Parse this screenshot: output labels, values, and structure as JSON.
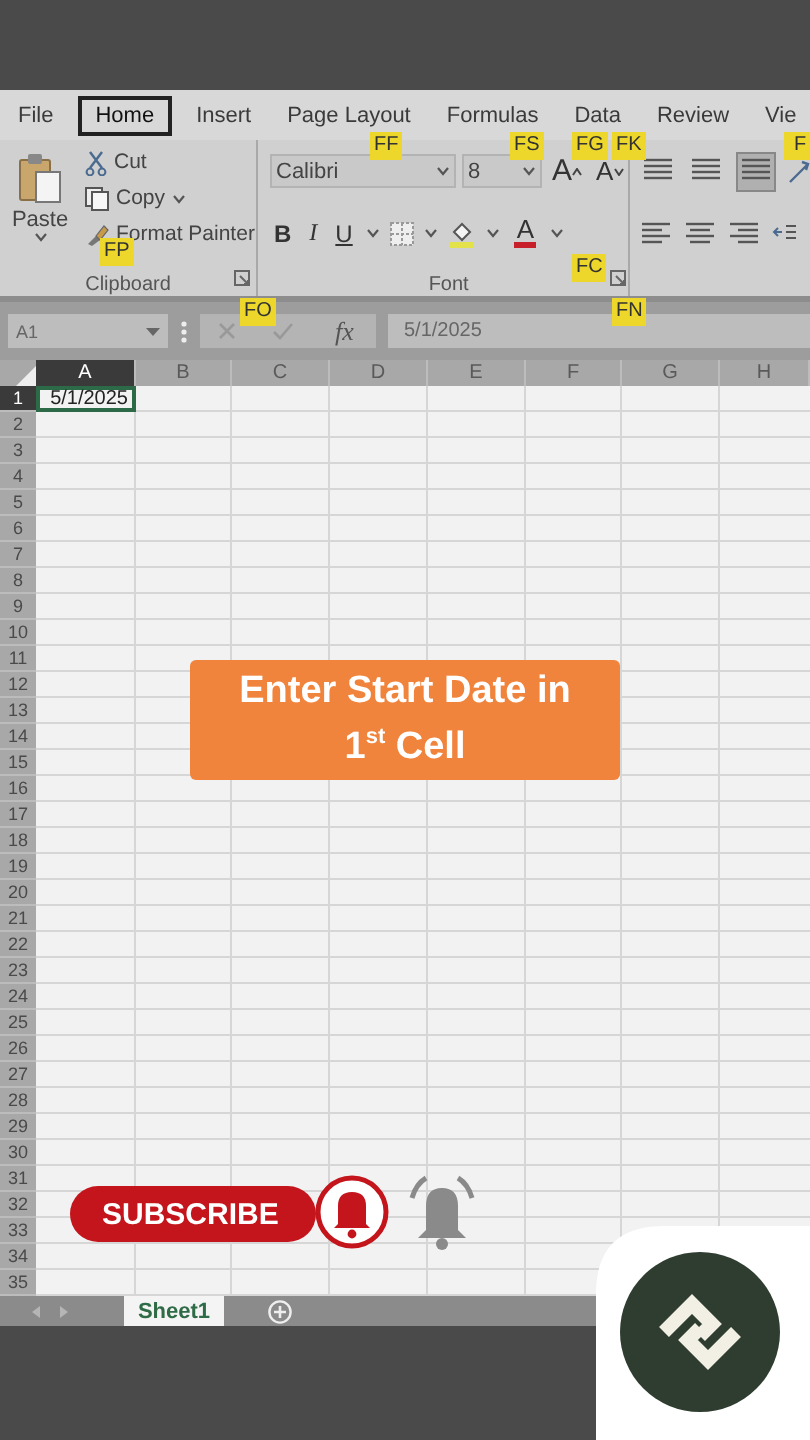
{
  "ribbon_tabs": [
    {
      "label": "File",
      "selected": false
    },
    {
      "label": "Home",
      "selected": true
    },
    {
      "label": "Insert",
      "selected": false
    },
    {
      "label": "Page Layout",
      "selected": false
    },
    {
      "label": "Formulas",
      "selected": false
    },
    {
      "label": "Data",
      "selected": false
    },
    {
      "label": "Review",
      "selected": false
    },
    {
      "label": "Vie",
      "selected": false
    }
  ],
  "clipboard": {
    "paste": "Paste",
    "cut": "Cut",
    "copy": "Copy",
    "format_painter": "Format Painter",
    "group_label": "Clipboard"
  },
  "font": {
    "font_name": "Calibri",
    "font_size": "8",
    "grow": "A",
    "shrink": "A",
    "bold": "B",
    "italic": "I",
    "underline": "U",
    "font_color": "A",
    "group_label": "Font"
  },
  "key_tips": [
    {
      "text": "FF",
      "kind": "fontname"
    },
    {
      "text": "FS",
      "kind": "fontsize"
    },
    {
      "text": "FG",
      "kind": "grow"
    },
    {
      "text": "FK",
      "kind": "shrink"
    },
    {
      "text": "F",
      "kind": "alignment"
    },
    {
      "text": "FP",
      "kind": "painter"
    },
    {
      "text": "FC",
      "kind": "fontcolor"
    },
    {
      "text": "FO",
      "kind": "cliplauncher"
    },
    {
      "text": "FN",
      "kind": "fontlauncher"
    }
  ],
  "formula_bar": {
    "name_box": "A1",
    "function_label": "fx",
    "value": "5/1/2025"
  },
  "sheet": {
    "columns": [
      {
        "label": "A",
        "selected": true
      },
      {
        "label": "B",
        "selected": false
      },
      {
        "label": "C",
        "selected": false
      },
      {
        "label": "D",
        "selected": false
      },
      {
        "label": "E",
        "selected": false
      },
      {
        "label": "F",
        "selected": false
      },
      {
        "label": "G",
        "selected": false
      },
      {
        "label": "H",
        "selected": false
      }
    ],
    "rows": [
      {
        "label": "1",
        "selected": true,
        "cells": [
          "5/1/2025"
        ]
      },
      {
        "label": "2",
        "selected": false
      },
      {
        "label": "3",
        "selected": false
      },
      {
        "label": "4",
        "selected": false
      },
      {
        "label": "5",
        "selected": false
      },
      {
        "label": "6",
        "selected": false
      },
      {
        "label": "7",
        "selected": false
      },
      {
        "label": "8",
        "selected": false
      },
      {
        "label": "9",
        "selected": false
      },
      {
        "label": "10",
        "selected": false
      },
      {
        "label": "11",
        "selected": false
      },
      {
        "label": "12",
        "selected": false
      },
      {
        "label": "13",
        "selected": false
      },
      {
        "label": "14",
        "selected": false
      },
      {
        "label": "15",
        "selected": false
      },
      {
        "label": "16",
        "selected": false
      },
      {
        "label": "17",
        "selected": false
      },
      {
        "label": "18",
        "selected": false
      },
      {
        "label": "19",
        "selected": false
      },
      {
        "label": "20",
        "selected": false
      },
      {
        "label": "21",
        "selected": false
      },
      {
        "label": "22",
        "selected": false
      },
      {
        "label": "23",
        "selected": false
      },
      {
        "label": "24",
        "selected": false
      },
      {
        "label": "25",
        "selected": false
      },
      {
        "label": "26",
        "selected": false
      },
      {
        "label": "27",
        "selected": false
      },
      {
        "label": "28",
        "selected": false
      },
      {
        "label": "29",
        "selected": false
      },
      {
        "label": "30",
        "selected": false
      },
      {
        "label": "31",
        "selected": false
      },
      {
        "label": "32",
        "selected": false
      },
      {
        "label": "33",
        "selected": false
      },
      {
        "label": "34",
        "selected": false
      },
      {
        "label": "35",
        "selected": false
      }
    ]
  },
  "sheet_tabs": [
    {
      "label": "Sheet1",
      "selected": true
    }
  ],
  "callout": {
    "text": "Enter Start Date in 1$^{st}$ Cell"
  },
  "subscribe": {
    "label": "SUBSCRIBE"
  }
}
